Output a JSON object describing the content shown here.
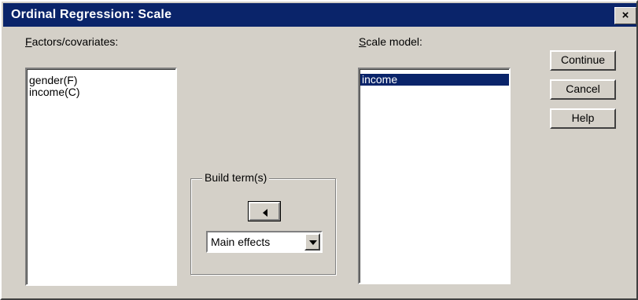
{
  "window": {
    "title": "Ordinal Regression: Scale",
    "close_glyph": "×"
  },
  "factors": {
    "label_accel": "F",
    "label_rest": "actors/covariates:",
    "items": [
      "gender(F)",
      "income(C)"
    ]
  },
  "scale": {
    "label_accel": "S",
    "label_rest": "cale model:",
    "items": [
      "income"
    ],
    "selected_index": 0
  },
  "build": {
    "title": "Build term(s)",
    "move_icon": "left-arrow-icon",
    "combo_value": "Main effects"
  },
  "buttons": {
    "continue": "Continue",
    "cancel": "Cancel",
    "help": "Help"
  },
  "colors": {
    "face": "#d4d0c8",
    "titlebar": "#0a246a",
    "selection": "#0a246a"
  }
}
